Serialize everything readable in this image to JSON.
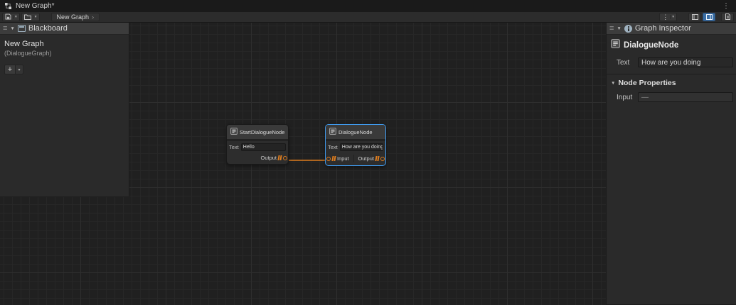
{
  "titlebar": {
    "title": "New Graph*",
    "kebab_icon": "⋮"
  },
  "toolbar": {
    "breadcrumb": "New Graph",
    "breadcrumb_chevron": "›",
    "dropdown_arrow": "▾",
    "kebab_icon": "⋮"
  },
  "blackboard": {
    "drag_handle": "≡",
    "collapse_icon": "▼",
    "title": "Blackboard",
    "graph_name": "New Graph",
    "graph_type": "(DialogueGraph)",
    "add_button": "+",
    "add_dropdown": "▾"
  },
  "inspector": {
    "drag_handle": "≡",
    "collapse_icon": "▼",
    "title": "Graph Inspector",
    "node_title": "DialogueNode",
    "text_label": "Text",
    "text_value": "How are you doing",
    "section_collapse": "▼",
    "section_title": "Node Properties",
    "input_label": "Input",
    "input_value": "—"
  },
  "nodes": {
    "start": {
      "title": "StartDialogueNode",
      "text_label": "Text",
      "text_value": "Hello",
      "output_label": "Output"
    },
    "dialogue": {
      "title": "DialogueNode",
      "text_label": "Text",
      "text_value": "How are you doing",
      "input_label": "Input",
      "output_label": "Output"
    }
  },
  "colors": {
    "selection_blue": "#3f9bf0",
    "accent_blue": "#3a6ea5",
    "port_orange": "#dd7c1e"
  }
}
